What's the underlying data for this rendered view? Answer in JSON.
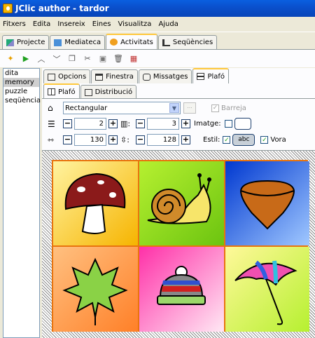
{
  "window": {
    "title": "JClic author - tardor"
  },
  "menu": [
    "Fitxers",
    "Edita",
    "Insereix",
    "Eines",
    "Visualitza",
    "Ajuda"
  ],
  "main_tabs": [
    {
      "label": "Projecte",
      "icon": "project-icon"
    },
    {
      "label": "Mediateca",
      "icon": "media-icon"
    },
    {
      "label": "Activitats",
      "icon": "activities-icon",
      "active": true
    },
    {
      "label": "Seqüències",
      "icon": "sequences-icon"
    }
  ],
  "toolbar": [
    "new-activity-icon",
    "play-icon",
    "move-up-icon",
    "move-down-icon",
    "copy-icon",
    "cut-icon",
    "paste-icon",
    "delete-icon",
    "grid-icon"
  ],
  "activities": [
    "dita",
    "memory",
    "puzzle",
    "seqüència"
  ],
  "selected_activity": "memory",
  "sub_tabs": [
    {
      "label": "Opcions"
    },
    {
      "label": "Finestra"
    },
    {
      "label": "Missatges"
    },
    {
      "label": "Plafó",
      "active": true
    }
  ],
  "inner_tabs": [
    {
      "label": "Plafó",
      "active": true
    },
    {
      "label": "Distribució"
    }
  ],
  "shape": {
    "value": "Rectangular",
    "barreja_label": "Barreja",
    "barreja_checked": true,
    "more_label": "..."
  },
  "rows": {
    "value": "2",
    "cols": "3",
    "image_label": "Imatge:"
  },
  "size": {
    "width": "130",
    "height": "128",
    "style_label": "Estil:",
    "style_value": "abc",
    "border_label": "Vora",
    "border_checked": true
  },
  "tiles": [
    "mushroom",
    "snail",
    "chestnut",
    "leaf",
    "hat",
    "umbrella"
  ],
  "colors": {
    "accent": "#e8740e",
    "title": "#0a4fcb"
  }
}
